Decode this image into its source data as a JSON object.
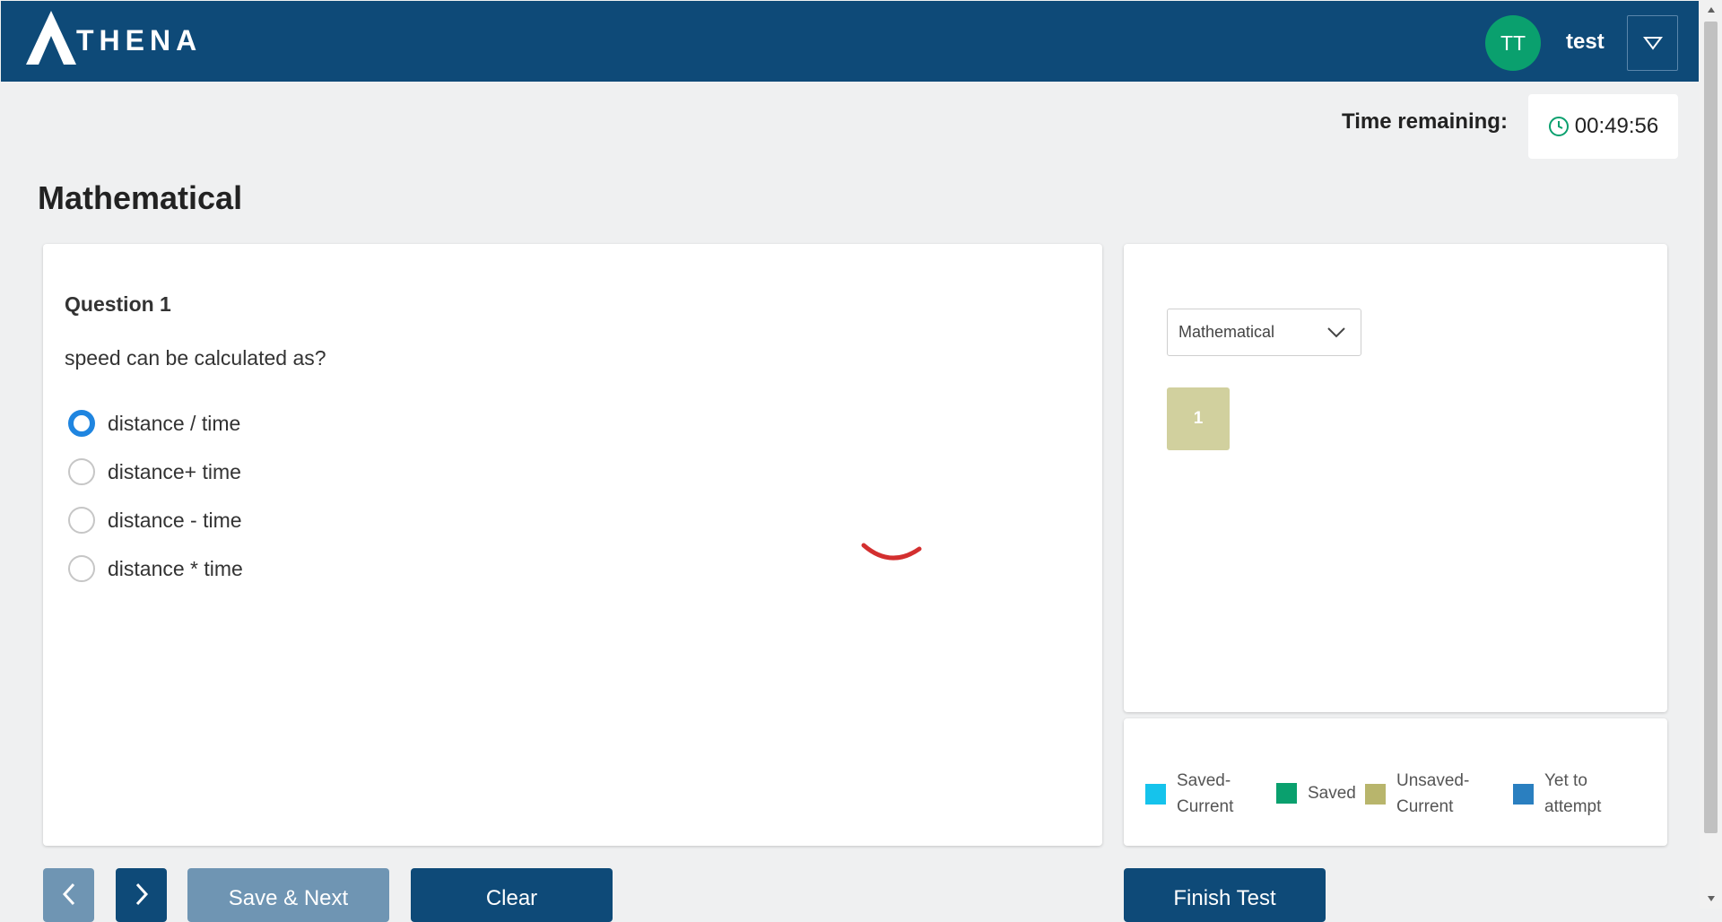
{
  "header": {
    "brand": "THENA",
    "avatar_initials": "TT",
    "username": "test",
    "colors": {
      "bar": "#0e4a78",
      "avatar": "#0aa06e"
    }
  },
  "timer": {
    "label": "Time remaining:",
    "value": "00:49:56",
    "icon": "clock-icon"
  },
  "section": {
    "title": "Mathematical"
  },
  "question": {
    "number_label": "Question 1",
    "text": "speed can be calculated as?",
    "options": [
      {
        "label": "distance / time",
        "selected": true
      },
      {
        "label": "distance+ time",
        "selected": false
      },
      {
        "label": "distance - time",
        "selected": false
      },
      {
        "label": "distance * time",
        "selected": false
      }
    ]
  },
  "navigator": {
    "section_select": "Mathematical",
    "question_tiles": [
      {
        "number": "1",
        "status": "unsaved-current"
      }
    ]
  },
  "legend": [
    {
      "label_line1": "Saved-",
      "label_line2": "Current",
      "color": "#15c3ec"
    },
    {
      "label_line1": "Saved",
      "label_line2": "",
      "color": "#0aa06e"
    },
    {
      "label_line1": "Unsaved-",
      "label_line2": "Current",
      "color": "#b8b56c"
    },
    {
      "label_line1": "Yet to",
      "label_line2": "attempt",
      "color": "#2a7fc0"
    }
  ],
  "buttons": {
    "save_next": "Save & Next",
    "clear": "Clear",
    "finish": "Finish Test"
  }
}
